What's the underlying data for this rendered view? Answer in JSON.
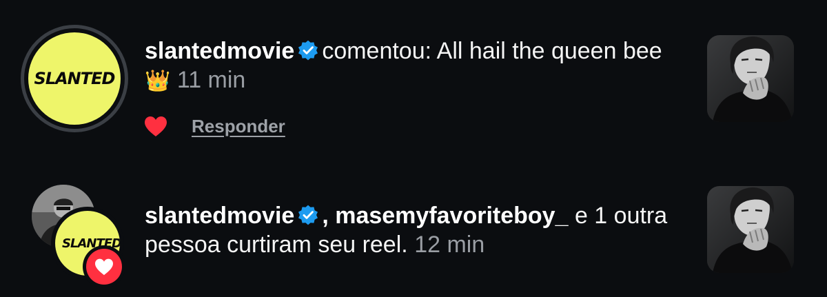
{
  "notifications": [
    {
      "username": "slantedmovie",
      "avatar_text": "SLANTED",
      "message": "comentou: All hail the queen bee",
      "emoji": "👑",
      "time": "11 min",
      "reply_label": "Responder",
      "thumbnail": "reel-thumbnail"
    },
    {
      "username": "slantedmovie",
      "separator": ",",
      "username2": "masemyfavoriteboy_",
      "message": "e 1 outra pessoa curtiram seu reel.",
      "time": "12 min",
      "avatar_text": "SLANTED",
      "thumbnail": "reel-thumbnail"
    }
  ],
  "colors": {
    "background": "#0b0d10",
    "brand_yellow": "#eef56a",
    "verified_blue": "#1d9bf0",
    "like_red": "#ff3040",
    "muted_text": "#9a9ea4"
  }
}
